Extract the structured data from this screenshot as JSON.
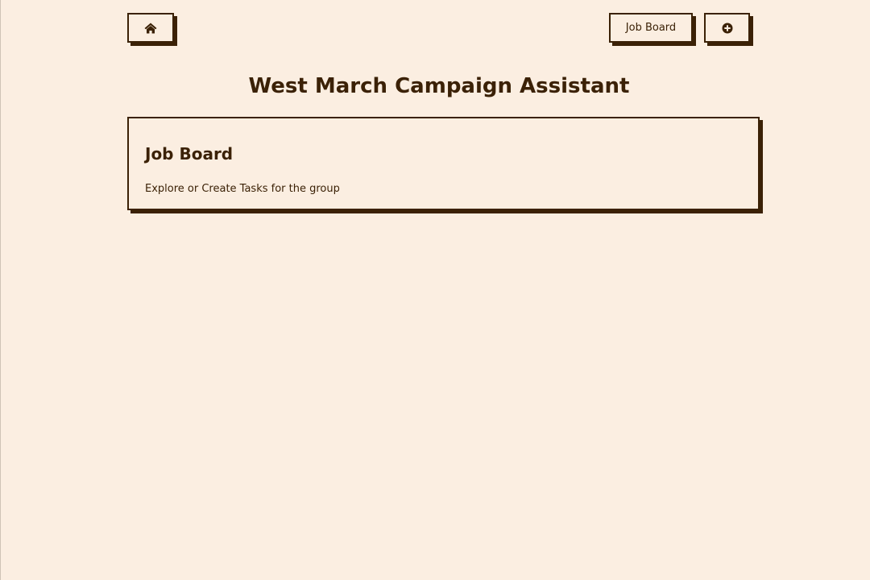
{
  "nav": {
    "home_icon": "home-icon",
    "job_board_label": "Job Board",
    "add_icon": "plus-circle-icon"
  },
  "header": {
    "title": "West March Campaign Assistant"
  },
  "cards": [
    {
      "title": "Job Board",
      "description": "Explore or Create Tasks for the group"
    }
  ],
  "colors": {
    "background": "#fbeee1",
    "accent": "#3b2106"
  }
}
